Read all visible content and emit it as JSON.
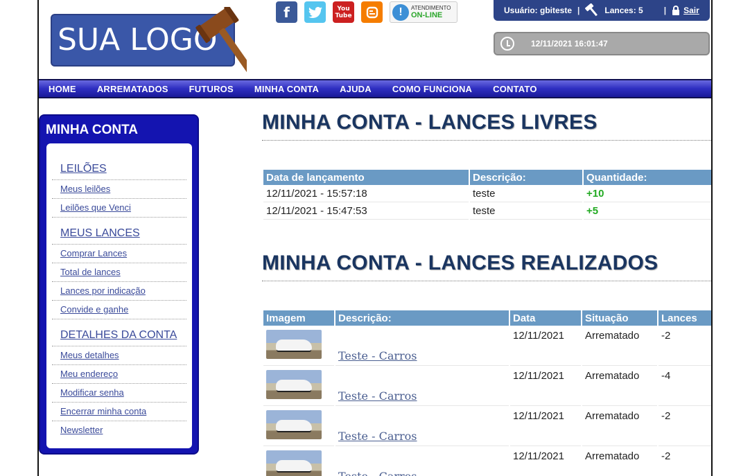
{
  "header": {
    "logo_text": "SUA LOGO",
    "social": {
      "facebook": "f",
      "youtube": "You Tube"
    },
    "atendimento": {
      "line1": "ATENDIMENTO",
      "line2": "ON-LINE"
    },
    "user_label": "Usuário: gbiteste",
    "lances_label": "Lances: 5",
    "sair_label": "Sair",
    "datetime": "12/11/2021 16:01:47"
  },
  "nav": [
    "HOME",
    "ARREMATADOS",
    "FUTUROS",
    "MINHA CONTA",
    "AJUDA",
    "COMO FUNCIONA",
    "CONTATO"
  ],
  "sidebar": {
    "title": "MINHA CONTA",
    "sections": [
      {
        "title": "LEILÕES",
        "links": [
          "Meus leilões",
          "Leilões que Venci"
        ]
      },
      {
        "title": "MEUS LANCES",
        "links": [
          "Comprar Lances",
          "Total de lances",
          "Lances por indicação",
          "Convide e ganhe"
        ]
      },
      {
        "title": "DETALHES DA CONTA",
        "links": [
          "Meus detalhes",
          "Meu endereço",
          "Modificar senha",
          "Encerrar minha conta",
          "Newsletter"
        ]
      }
    ]
  },
  "livres": {
    "title": "MINHA CONTA - LANCES LIVRES",
    "headers": [
      "Data de lançamento",
      "Descrição:",
      "Quantidade:"
    ],
    "rows": [
      {
        "data": "12/11/2021 - 15:57:18",
        "desc": "teste",
        "qtd": "+10"
      },
      {
        "data": "12/11/2021 - 15:47:53",
        "desc": "teste",
        "qtd": "+5"
      }
    ]
  },
  "realizados": {
    "title": "MINHA CONTA - LANCES REALIZADOS",
    "headers": [
      "Imagem",
      "Descrição:",
      "Data",
      "Situação",
      "Lances"
    ],
    "rows": [
      {
        "desc": "Teste - Carros",
        "data": "12/11/2021",
        "situacao": "Arrematado",
        "lances": "-2"
      },
      {
        "desc": "Teste - Carros",
        "data": "12/11/2021",
        "situacao": "Arrematado",
        "lances": "-4"
      },
      {
        "desc": "Teste - Carros",
        "data": "12/11/2021",
        "situacao": "Arrematado",
        "lances": "-2"
      },
      {
        "desc": "Teste - Carros",
        "data": "12/11/2021",
        "situacao": "Arrematado",
        "lances": "-2"
      }
    ]
  }
}
